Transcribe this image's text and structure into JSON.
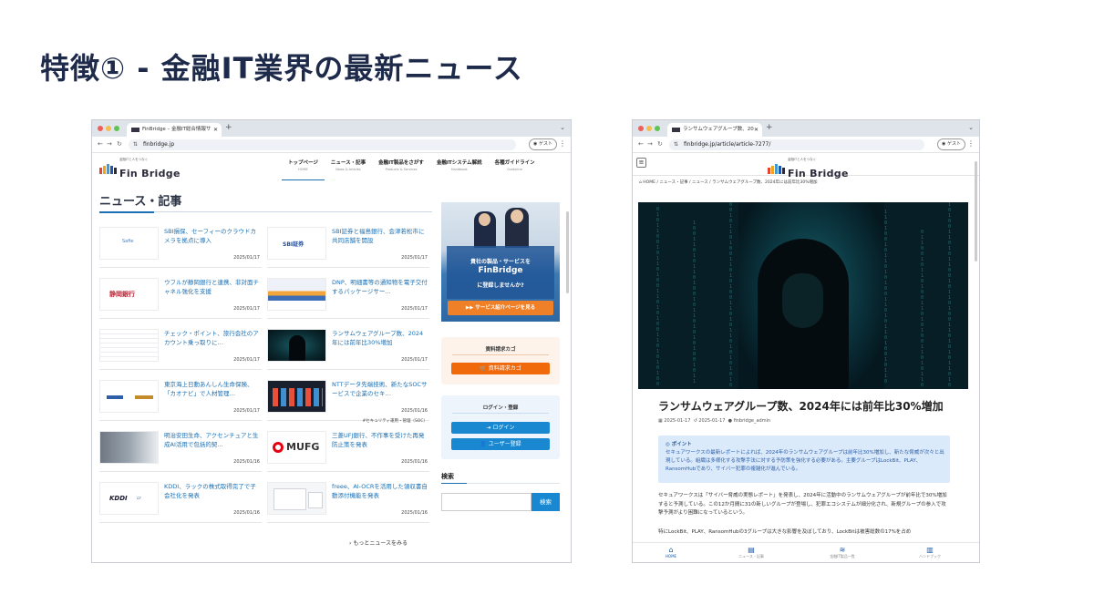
{
  "slide_title": "特徴① - 金融IT業界の最新ニュース",
  "colors": {
    "brand_blue": "#1b6fb3",
    "button_blue": "#1a88d0",
    "orange": "#f06a0c",
    "title_navy": "#1e2a4a"
  },
  "win1": {
    "tab_title": "FinBridge – 金融IT総合情報サ",
    "url": "finbridge.jp",
    "guest_label": "ゲスト",
    "logo": {
      "sub": "金融ITと人をつなぐ",
      "name": "Fin Bridge"
    },
    "nav": [
      {
        "label": "トップページ",
        "sub": "HOME"
      },
      {
        "label": "ニュース・記事",
        "sub": "News & Articles"
      },
      {
        "label": "金融IT製品をさがす",
        "sub": "Products & Services"
      },
      {
        "label": "金融ITシステム解説",
        "sub": "Handbook"
      },
      {
        "label": "各種ガイドライン",
        "sub": "Guideline"
      }
    ],
    "section_title": "ニュース・記事",
    "articles": [
      {
        "title": "SBI損保、セーフィーのクラウドカメラを拠点に導入",
        "date": "2025/01/17",
        "thumb": "Safie"
      },
      {
        "title": "SBI証券と福島銀行、会津若松市に共同店舗を開設",
        "date": "2025/01/17",
        "thumb": "SBI証券"
      },
      {
        "title": "ウフルが静岡銀行と連携、非対面チャネル強化を支援",
        "date": "2025/01/17",
        "thumb": "静岡銀行"
      },
      {
        "title": "DNP、明細書等の通知物を電子交付するパッケージサー…",
        "date": "2025/01/17",
        "thumb": ""
      },
      {
        "title": "チェック・ポイント、旅行会社のアカウント乗っ取りに…",
        "date": "2025/01/17",
        "thumb": ""
      },
      {
        "title": "ランサムウェアグループ数、2024年には前年比30%増加",
        "date": "2025/01/17",
        "thumb": ""
      },
      {
        "title": "東京海上日動あんしん生命保険、「カオナビ」で人材管理…",
        "date": "2025/01/17",
        "thumb": ""
      },
      {
        "title": "NTTデータ先端技術、新たなSOCサービスで企業のセキ…",
        "date": "2025/01/16",
        "tag": "#セキュリティ運用・管理（SOC）",
        "thumb": ""
      },
      {
        "title": "明治安田生命、アクセンチュアと生成AI活用で包括的契…",
        "date": "2025/01/16",
        "thumb": ""
      },
      {
        "title": "三菱UFJ銀行、不作事を受けた再発防止策を発表",
        "date": "2025/01/16",
        "thumb": "MUFG"
      },
      {
        "title": "KDDI、ラックの株式取得完了で子会社化を発表",
        "date": "2025/01/16",
        "thumb": "KDDI"
      },
      {
        "title": "freee、AI-OCRを活用した領収書自動添付機能を発表",
        "date": "2025/01/16",
        "thumb": ""
      }
    ],
    "more_link": "もっとニュースをみる",
    "banner": {
      "line1": "貴社の製品・サービスを",
      "logo": "FinBridge",
      "line2": "に登録しませんか?",
      "button": "▶▶ サービス紹介ページを見る"
    },
    "cart": {
      "title": "資料請求カゴ",
      "button": "資料請求カゴ"
    },
    "login": {
      "title": "ログイン・登録",
      "login_btn": "ログイン",
      "register_btn": "ユーザー登録"
    },
    "search": {
      "title": "検索",
      "placeholder": "",
      "button": "検索"
    }
  },
  "win2": {
    "tab_title": "ランサムウェアグループ数、20",
    "url": "finbridge.jp/article/article-7277/",
    "guest_label": "ゲスト",
    "logo": {
      "sub": "金融ITと人をつなぐ",
      "name": "Fin Bridge"
    },
    "breadcrumb": "HOME / ニュース・記事 / ニュース / ランサムウェアグループ数、2024年には前年比30%増加",
    "article_title": "ランサムウェアグループ数、2024年には前年比30%増加",
    "meta": {
      "published": "2025-01-17",
      "updated": "2025-01-17",
      "author": "finbridge_admin"
    },
    "point": {
      "heading": "ポイント",
      "body": "セキュアワークスの最新レポートによれば、2024年のランサムウェアグループは前年比30%増加し、新たな脅威が次々と出現している。組織は多様化する攻撃手法に対する予防策を強化する必要がある。主要グループはLockBit、PLAY、RansomHubであり、サイバー犯罪の複雑化が進んでいる。"
    },
    "body1": "セキュアワークスは「サイバー脅威の実態レポート」を発表し、2024年に活動中のランサムウェアグループが前年比で30%増加すると予測している。この12か月間に31の新しいグループが登場し、犯罪エコシステムが細分化され、新規グループの参入で攻撃予測がより困難になっているという。",
    "body2": "特にLockBit、PLAY、RansomHubの3グループは大きな影響を及ぼしており、LockBitは被害総数の17%を占め",
    "bottom_nav": [
      {
        "label": "HOME",
        "icon": "home-icon"
      },
      {
        "label": "ニュース・記事",
        "icon": "news-icon"
      },
      {
        "label": "金融IT製品一覧",
        "icon": "layers-icon"
      },
      {
        "label": "ハンドブック",
        "icon": "book-icon"
      }
    ]
  }
}
